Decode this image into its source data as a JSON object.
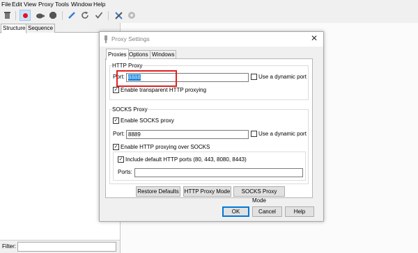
{
  "menu": [
    "File",
    "Edit",
    "View",
    "Proxy",
    "Tools",
    "Window",
    "Help"
  ],
  "toolbar": {
    "icons": [
      "trash-icon",
      "record-icon",
      "turtle-icon",
      "breakpoint-icon",
      "pen-icon",
      "refresh-icon",
      "check-icon",
      "settings-tools-icon",
      "gear-icon"
    ]
  },
  "left_tabs": [
    "Structure",
    "Sequence"
  ],
  "filter_label": "Filter:",
  "dialog": {
    "title": "Proxy Settings",
    "tabs": [
      "Proxies",
      "Options",
      "Windows"
    ],
    "http": {
      "group_title": "HTTP Proxy",
      "port_label": "Port:",
      "port_value": "8888",
      "dynamic_label": "Use a dynamic port",
      "dynamic_checked": false,
      "transparent_label": "Enable transparent HTTP proxying",
      "transparent_checked": true
    },
    "socks": {
      "group_title": "SOCKS Proxy",
      "enable_label": "Enable SOCKS proxy",
      "enable_checked": true,
      "port_label": "Port:",
      "port_value": "8889",
      "dynamic_label": "Use a dynamic port",
      "dynamic_checked": false,
      "over_socks_label": "Enable HTTP proxying over SOCKS",
      "over_socks_checked": true,
      "include_label": "Include default HTTP ports (80, 443, 8080, 8443)",
      "include_checked": true,
      "ports_label": "Ports:",
      "ports_value": ""
    },
    "buttons": {
      "restore": "Restore Defaults",
      "http_mode": "HTTP Proxy Mode",
      "socks_mode": "SOCKS Proxy Mode",
      "ok": "OK",
      "cancel": "Cancel",
      "help": "Help"
    }
  },
  "colors": {
    "highlight": "#e02020",
    "selection": "#0078d7",
    "record": "#e81123"
  }
}
